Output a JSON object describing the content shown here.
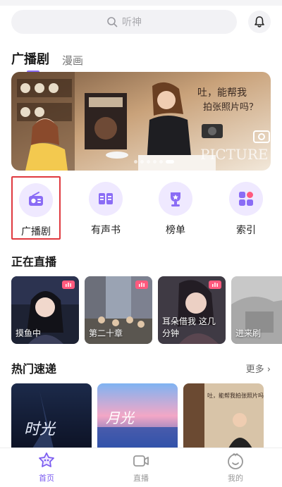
{
  "search": {
    "placeholder": "听神"
  },
  "tabs": [
    {
      "label": "广播剧",
      "active": true
    },
    {
      "label": "漫画",
      "active": false
    }
  ],
  "banner": {
    "overlay_text": [
      "吐，能帮我",
      "拍张照片吗？"
    ],
    "picture_word": "PICTURE",
    "dot_count": 6,
    "active_dot": 5
  },
  "quick_nav": [
    {
      "label": "广播剧",
      "icon": "radio-icon",
      "selected": true
    },
    {
      "label": "有声书",
      "icon": "book-icon",
      "selected": false
    },
    {
      "label": "榜单",
      "icon": "trophy-icon",
      "selected": false
    },
    {
      "label": "索引",
      "icon": "grid-icon",
      "selected": false
    }
  ],
  "live": {
    "title": "正在直播",
    "cards": [
      {
        "title": "摸鱼中"
      },
      {
        "title": "第二十章"
      },
      {
        "title": "耳朵借我 这几分钟"
      },
      {
        "title": "进来刷"
      }
    ]
  },
  "hot": {
    "title": "热门速递",
    "more_label": "更多",
    "cards": [
      {
        "art_text": "时光"
      },
      {
        "art_text": "月光"
      },
      {
        "art_text": "吐，能帮我拍张照片吗？"
      }
    ]
  },
  "bottom_nav": [
    {
      "label": "首页",
      "icon": "home-icon",
      "active": true
    },
    {
      "label": "直播",
      "icon": "live-camera-icon",
      "active": false
    },
    {
      "label": "我的",
      "icon": "profile-icon",
      "active": false
    }
  ],
  "colors": {
    "accent": "#8a6cf5",
    "icon_bg": "#efe9ff",
    "selection_box": "#e0393f",
    "badge": "#ff5a7e"
  }
}
